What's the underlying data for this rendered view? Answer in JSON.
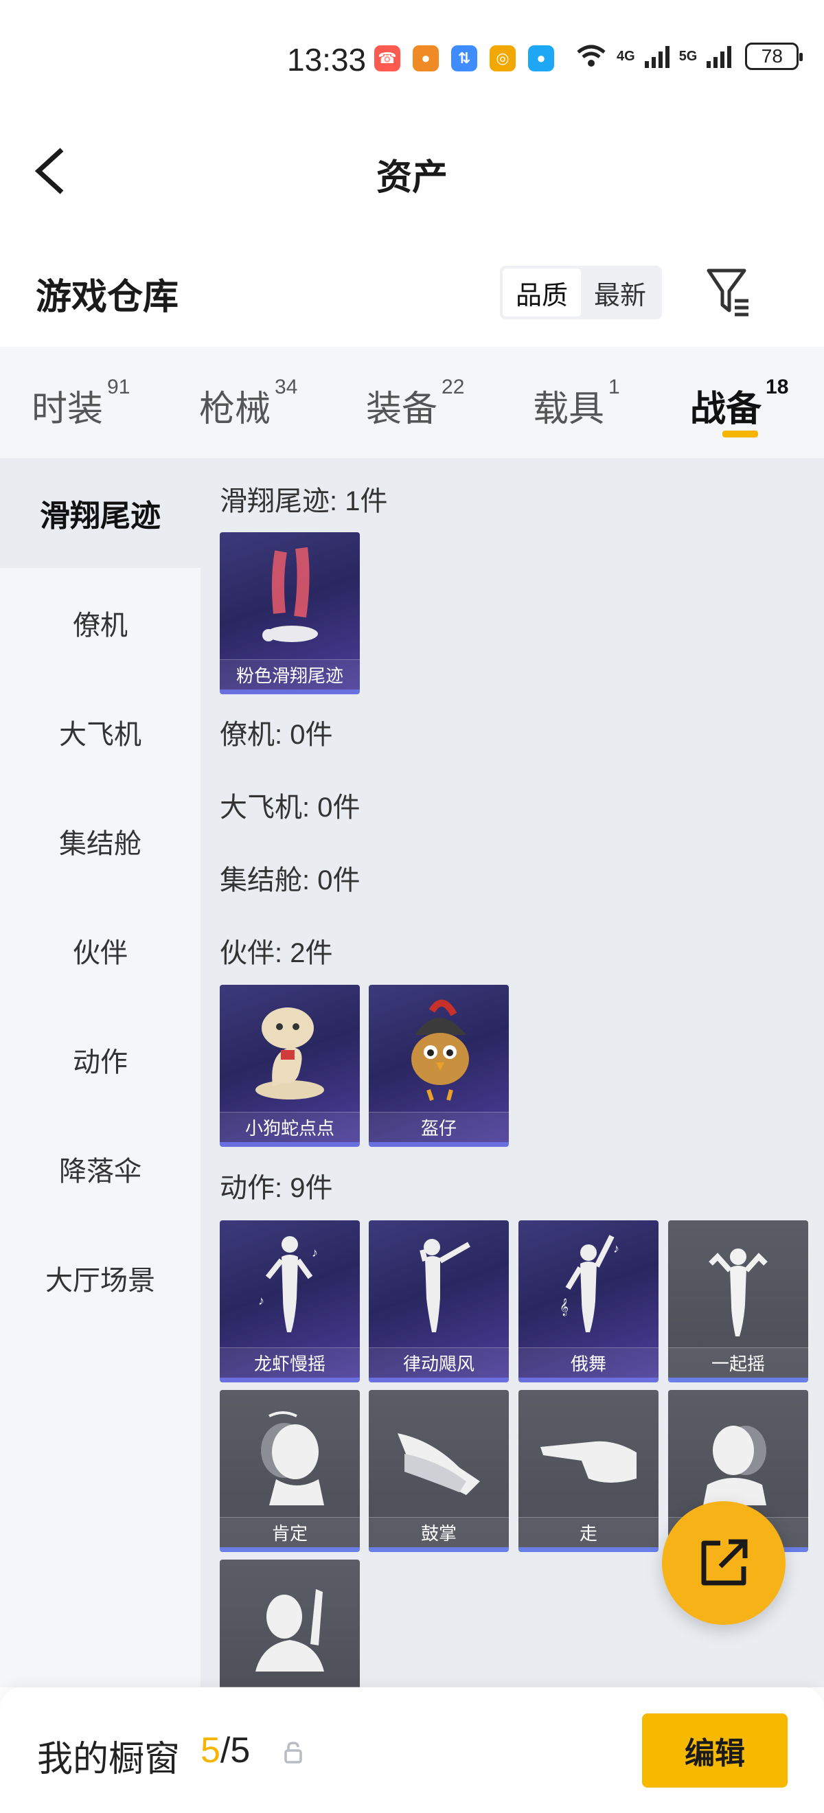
{
  "status_bar": {
    "time": "13:33",
    "net1": "4G",
    "net2": "5G",
    "battery": "78"
  },
  "header": {
    "title": "资产"
  },
  "section": {
    "title": "游戏仓库",
    "sort_options": [
      "品质",
      "最新"
    ],
    "active_sort": "品质"
  },
  "tabs": [
    {
      "label": "时装",
      "count": "91"
    },
    {
      "label": "枪械",
      "count": "34"
    },
    {
      "label": "装备",
      "count": "22"
    },
    {
      "label": "载具",
      "count": "1"
    },
    {
      "label": "战备",
      "count": "18",
      "active": true
    }
  ],
  "sidenav": [
    {
      "label": "滑翔尾迹",
      "active": true
    },
    {
      "label": "僚机"
    },
    {
      "label": "大飞机"
    },
    {
      "label": "集结舱"
    },
    {
      "label": "伙伴"
    },
    {
      "label": "动作"
    },
    {
      "label": "降落伞"
    },
    {
      "label": "大厅场景"
    }
  ],
  "groups": {
    "glide": {
      "label": "滑翔尾迹: 1件",
      "items": [
        "粉色滑翔尾迹"
      ]
    },
    "wingman": {
      "label": "僚机: 0件"
    },
    "plane": {
      "label": "大飞机: 0件"
    },
    "capsule": {
      "label": "集结舱: 0件"
    },
    "partner": {
      "label": "伙伴: 2件",
      "items": [
        "小狗蛇点点",
        "盔仔"
      ]
    },
    "action": {
      "label": "动作: 9件",
      "items": [
        "龙虾慢摇",
        "律动飓风",
        "俄舞",
        "一起摇",
        "肯定",
        "鼓掌",
        "走",
        ""
      ]
    }
  },
  "bottom": {
    "label": "我的橱窗",
    "current": "5",
    "total": "/5",
    "edit": "编辑"
  },
  "colors": {
    "accent": "#f5b400",
    "card_purple": "#2a2760",
    "card_gray": "#4c4e57"
  }
}
